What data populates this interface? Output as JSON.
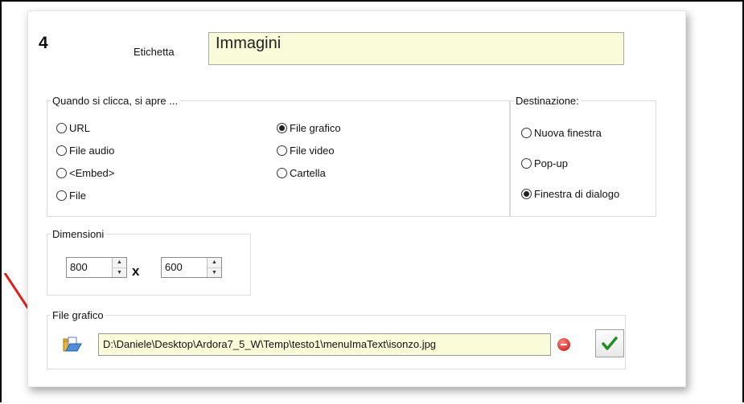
{
  "header": {
    "number": "4",
    "label_etichetta": "Etichetta",
    "etichetta_value": "Immagini"
  },
  "open_group": {
    "legend": "Quando si clicca, si apre ...",
    "options": [
      {
        "label": "URL",
        "selected": false
      },
      {
        "label": "File audio",
        "selected": false
      },
      {
        "label": "<Embed>",
        "selected": false
      },
      {
        "label": "File",
        "selected": false
      },
      {
        "label": "File grafico",
        "selected": true
      },
      {
        "label": "File video",
        "selected": false
      },
      {
        "label": "Cartella",
        "selected": false
      }
    ]
  },
  "dest_group": {
    "legend": "Destinazione:",
    "options": [
      {
        "label": "Nuova finestra",
        "selected": false
      },
      {
        "label": "Pop-up",
        "selected": false
      },
      {
        "label": "Finestra di dialogo",
        "selected": true
      }
    ]
  },
  "dimensions": {
    "legend": "Dimensioni",
    "width": "800",
    "times": "x",
    "height": "600"
  },
  "file": {
    "legend": "File grafico",
    "path": "D:\\Daniele\\Desktop\\Ardora7_5_W\\Temp\\testo1\\menuImaText\\isonzo.jpg"
  },
  "colors": {
    "input_bg": "#fafbd8",
    "arrow": "#e0201b",
    "ok_check": "#1f8f1f"
  }
}
